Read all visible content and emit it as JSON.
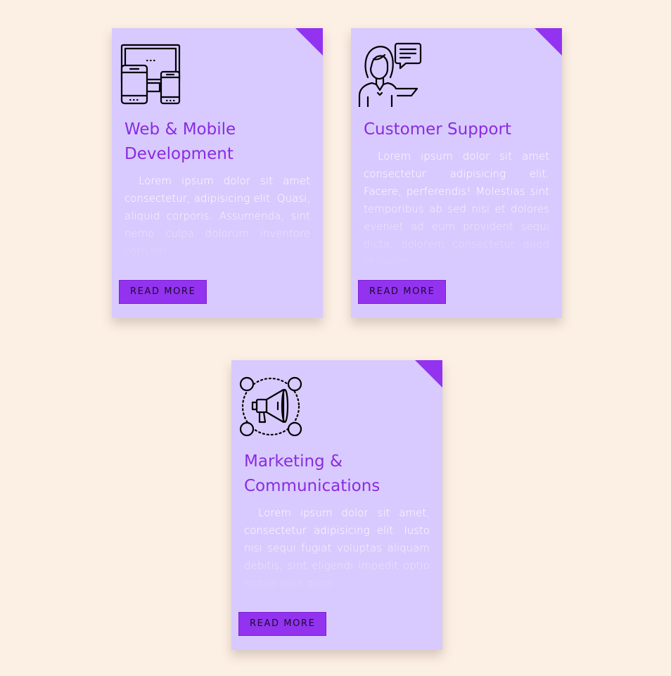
{
  "colors": {
    "background": "#fcefe3",
    "card": "#d8cafe",
    "accent": "#9333f0",
    "title": "#8a2be2",
    "body_text": "#ffffff"
  },
  "cards": [
    {
      "icon": "devices-icon",
      "title": "Web & Mobile Development",
      "description": "Lorem ipsum dolor sit amet consectetur, adipisicing elit. Quasi, aliquid corporis. Assumenda, sint nemo culpa dolorum inventore corrupti",
      "button_label": "READ MORE"
    },
    {
      "icon": "customer-support-icon",
      "title": "Customer Support",
      "description": "Lorem ipsum dolor sit amet consectetur adipisicing elit. Facere, perferendis! Molestias sint temporibus ab sed nisi et dolores eveniet ad eum provident sequi dicta, dolorem consectetur quod et ipsum",
      "button_label": "READ MORE"
    },
    {
      "icon": "megaphone-network-icon",
      "title": "Marketing & Communications",
      "description": "Lorem ipsum dolor sit amet, consectetur adipisicing elit. Iusto nisi sequi fugiat voluptas aliquam debitis, sint eligendi impedit optio minus esse quos",
      "button_label": "READ MORE"
    }
  ]
}
